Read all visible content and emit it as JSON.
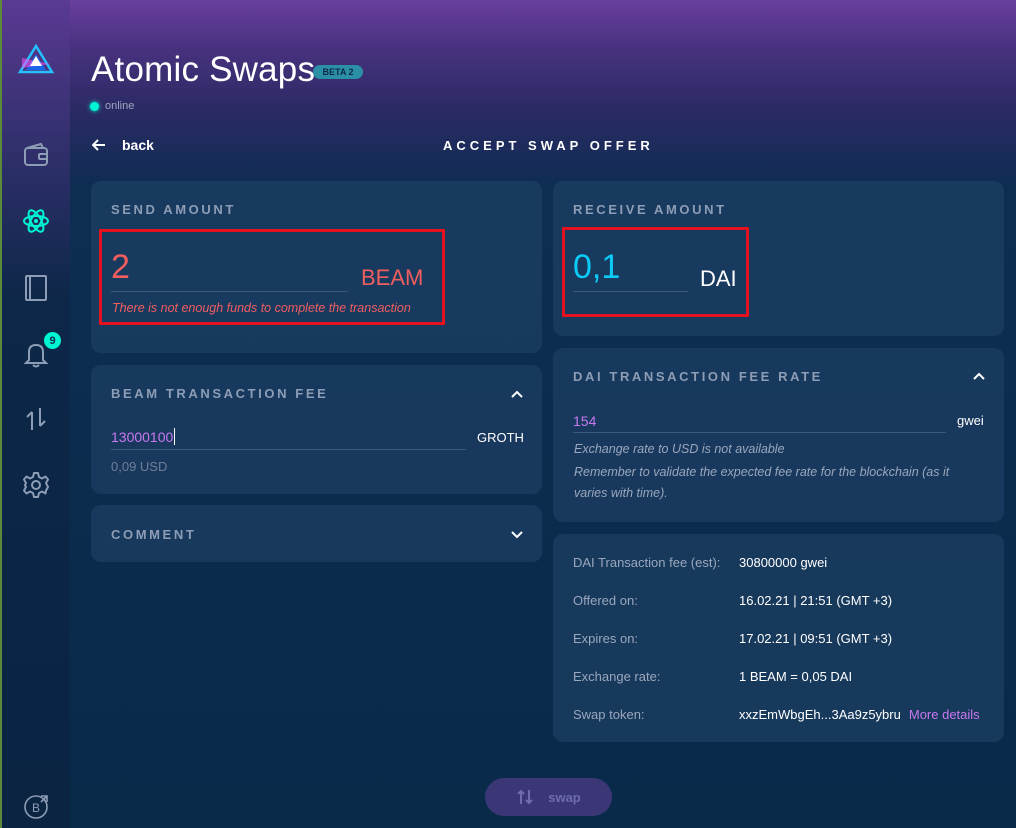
{
  "app": {
    "title": "Atomic Swaps",
    "beta_badge": "BETA 2",
    "status": "online"
  },
  "sidebar": {
    "items": [
      {
        "icon": "wallet-icon"
      },
      {
        "icon": "atomic-swap-icon",
        "active": true
      },
      {
        "icon": "address-book-icon"
      },
      {
        "icon": "notifications-icon",
        "badge": "9"
      },
      {
        "icon": "transactions-icon"
      },
      {
        "icon": "settings-icon"
      }
    ],
    "bottom_icon": "beam-explorer-icon"
  },
  "nav": {
    "back_label": "back",
    "page_title": "ACCEPT SWAP OFFER"
  },
  "send": {
    "title": "SEND AMOUNT",
    "value": "2",
    "currency": "BEAM",
    "error": "There is not enough funds to complete the transaction"
  },
  "receive": {
    "title": "RECEIVE AMOUNT",
    "value": "0,1",
    "currency": "DAI"
  },
  "beam_fee": {
    "title": "BEAM TRANSACTION FEE",
    "value": "13000100",
    "unit": "GROTH",
    "usd": "0,09 USD"
  },
  "comment": {
    "title": "COMMENT"
  },
  "dai_fee": {
    "title": "DAI TRANSACTION FEE RATE",
    "value": "154",
    "unit": "gwei",
    "note1": "Exchange rate to USD is not available",
    "note2": "Remember to validate the expected fee rate for the blockchain (as it varies with time)."
  },
  "details": {
    "rows": [
      {
        "label": "DAI Transaction fee (est):",
        "value": "30800000 gwei"
      },
      {
        "label": "Offered on:",
        "value": "16.02.21 | 21:51 (GMT +3)"
      },
      {
        "label": "Expires on:",
        "value": "17.02.21 | 09:51 (GMT +3)"
      },
      {
        "label": "Exchange rate:",
        "value": "1 BEAM = 0,05 DAI"
      },
      {
        "label": "Swap token:",
        "value": "xxzEmWbgEh...3Aa9z5ybru"
      }
    ],
    "more_details": "More details"
  },
  "actions": {
    "swap_label": "swap"
  },
  "colors": {
    "accent_teal": "#00f6d2",
    "error_red": "#f05e5e",
    "receive_blue": "#0bccf7",
    "purple_input": "#c878f0",
    "highlight_box": "#e4121f"
  }
}
